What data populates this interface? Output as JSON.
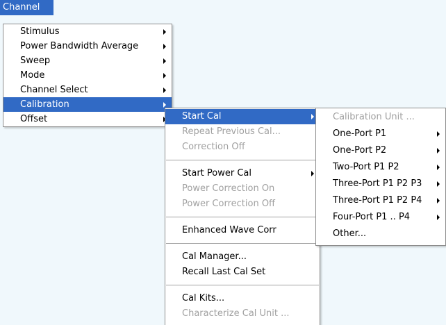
{
  "menubar": {
    "channel_label": "Channel"
  },
  "channel_menu": {
    "items": [
      {
        "label": "Stimulus"
      },
      {
        "label": "Power Bandwidth Average"
      },
      {
        "label": "Sweep"
      },
      {
        "label": "Mode"
      },
      {
        "label": "Channel Select"
      },
      {
        "label": "Calibration"
      },
      {
        "label": "Offset"
      }
    ]
  },
  "calibration_menu": {
    "items": [
      {
        "label": "Start Cal"
      },
      {
        "label": "Repeat Previous Cal..."
      },
      {
        "label": "Correction Off"
      },
      {
        "label": "Start Power Cal"
      },
      {
        "label": "Power Correction On"
      },
      {
        "label": "Power Correction Off"
      },
      {
        "label": "Enhanced Wave Corr"
      },
      {
        "label": "Cal Manager..."
      },
      {
        "label": "Recall Last Cal Set"
      },
      {
        "label": "Cal Kits..."
      },
      {
        "label": "Characterize Cal Unit ..."
      }
    ]
  },
  "start_cal_menu": {
    "items": [
      {
        "label": "Calibration Unit ..."
      },
      {
        "label": "One-Port P1"
      },
      {
        "label": "One-Port P2"
      },
      {
        "label": "Two-Port P1 P2"
      },
      {
        "label": "Three-Port P1 P2 P3"
      },
      {
        "label": "Three-Port P1 P2 P4"
      },
      {
        "label": "Four-Port P1 .. P4"
      },
      {
        "label": "Other..."
      }
    ]
  },
  "colors": {
    "highlight": "#316ac5",
    "disabled_text": "#a0a0a0",
    "background": "#f0f8fc"
  }
}
